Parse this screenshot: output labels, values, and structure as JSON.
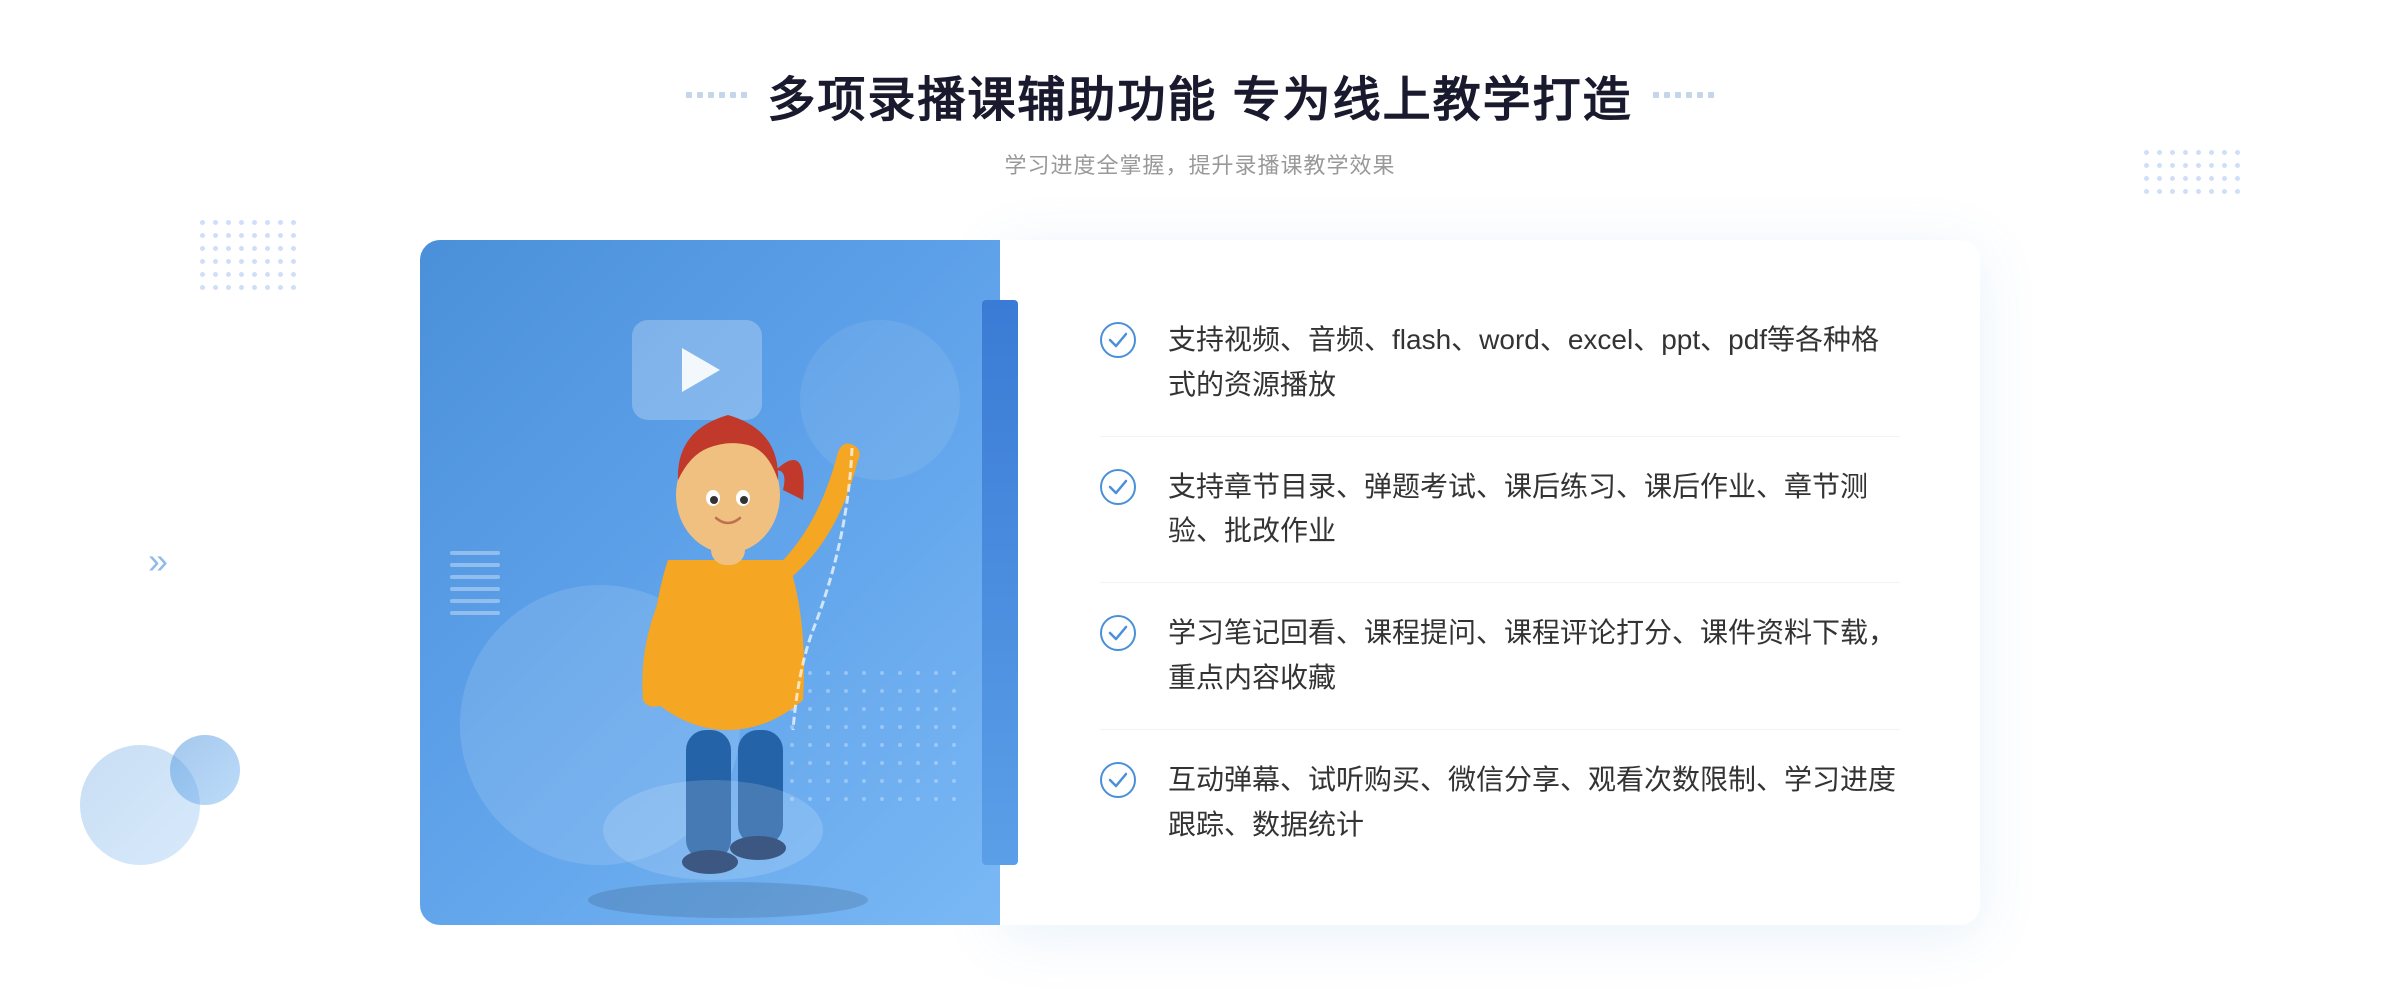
{
  "page": {
    "background_color": "#ffffff"
  },
  "header": {
    "title": "多项录播课辅助功能 专为线上教学打造",
    "subtitle": "学习进度全掌握，提升录播课教学效果"
  },
  "features": [
    {
      "id": 1,
      "text": "支持视频、音频、flash、word、excel、ppt、pdf等各种格式的资源播放"
    },
    {
      "id": 2,
      "text": "支持章节目录、弹题考试、课后练习、课后作业、章节测验、批改作业"
    },
    {
      "id": 3,
      "text": "学习笔记回看、课程提问、课程评论打分、课件资料下载，重点内容收藏"
    },
    {
      "id": 4,
      "text": "互动弹幕、试听购买、微信分享、观看次数限制、学习进度跟踪、数据统计"
    }
  ],
  "decorators": {
    "left_dots_label": "left-dot-pattern",
    "right_dots_label": "right-dot-pattern",
    "chevron": "»"
  }
}
